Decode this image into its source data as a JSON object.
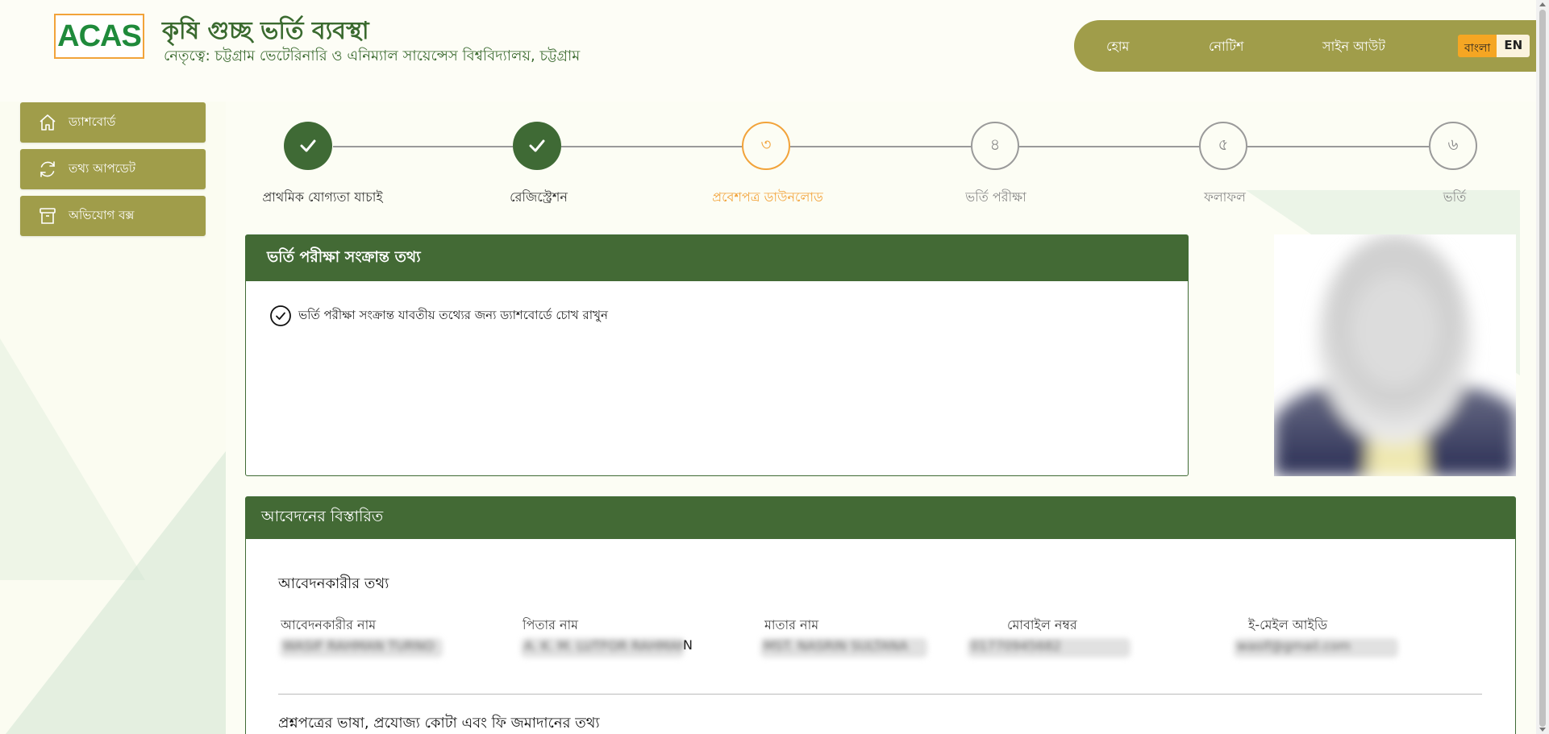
{
  "header": {
    "logo_text": "ACAS",
    "title": "কৃষি গুচ্ছ ভর্তি ব্যবস্থা",
    "subtitle": "নেতৃত্বে: চট্টগ্রাম ভেটেরিনারি ও এনিম্যাল সায়েন্সেস বিশ্ববিদ্যালয়, চট্টগ্রাম",
    "nav": [
      {
        "label": "হোম"
      },
      {
        "label": "নোটিশ"
      },
      {
        "label": "সাইন আউট"
      }
    ],
    "lang": {
      "bn": "বাংলা",
      "en": "EN"
    }
  },
  "sidebar": {
    "items": [
      {
        "label": "ড্যাশবোর্ড",
        "icon": "home-icon"
      },
      {
        "label": "তথ্য আপডেট",
        "icon": "refresh-icon"
      },
      {
        "label": "অভিযোগ বক্স",
        "icon": "archive-icon"
      }
    ]
  },
  "stepper": {
    "steps": [
      {
        "label": "প্রাথমিক যোগ্যতা যাচাই",
        "number": "",
        "state": "done"
      },
      {
        "label": "রেজিস্ট্রেশন",
        "number": "",
        "state": "done"
      },
      {
        "label": "প্রবেশপত্র ডাউনলোড",
        "number": "৩",
        "state": "current"
      },
      {
        "label": "ভর্তি পরীক্ষা",
        "number": "৪",
        "state": "future"
      },
      {
        "label": "ফলাফল",
        "number": "৫",
        "state": "future"
      },
      {
        "label": "ভর্তি",
        "number": "৬",
        "state": "future"
      }
    ]
  },
  "exam_info": {
    "title": "ভর্তি পরীক্ষা সংক্রান্ত তথ্য",
    "notice": "ভর্তি পরীক্ষা সংক্রান্ত যাবতীয় তথ্যের জন্য ড্যাশবোর্ডে চোখ রাখুন"
  },
  "application": {
    "title": "আবেদনের বিস্তারিত",
    "applicant_section": "আবেদনকারীর তথ্য",
    "fields": [
      {
        "label": "আবেদনকারীর নাম",
        "value": "WASIF RAHMAN TURNO"
      },
      {
        "label": "পিতার নাম",
        "value": "A. K. M. LUTFOR RAHMAN"
      },
      {
        "label": "মাতার নাম",
        "value": "MST. NASRIN SULTANA"
      },
      {
        "label": "মোবাইল নম্বর",
        "value": "01770945682"
      },
      {
        "label": "ই-মেইল আইডি",
        "value": "wasif@gmail.com"
      }
    ],
    "father_name_suffix": "N",
    "next_section": "প্রশ্নপত্রের ভাষা, প্রযোজ্য কোটা এবং ফি জমাদানের তথ্য"
  },
  "colors": {
    "primary_green": "#436a35",
    "olive": "#a09d4a",
    "accent_orange": "#f2a33a"
  }
}
